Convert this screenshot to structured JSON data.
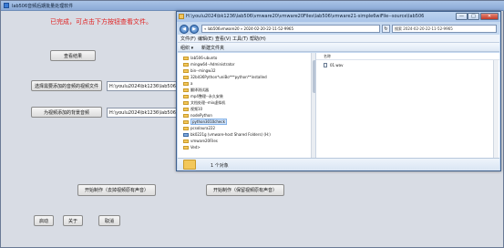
{
  "app": {
    "title": "lab506音频后期批量处理软件",
    "status": "已完成，可点击下方按钮查看文件。",
    "view_button": "查看结果",
    "select_dir_button": "选择需要添加的音频的视频文件",
    "select_dir_value": "H:\\youlu2024\\bk1236\\lab506\\",
    "bgm_button": "为视频添加的背景音频",
    "bgm_value": "H:\\youlu2024\\bk1236\\lab506\\",
    "start_remove_button": "开始制作（去掉视频原有声音）",
    "start_keep_button": "开始制作（保留视频原有声音）",
    "readme_button": "启动",
    "about_button": "关于",
    "close_button": "取消"
  },
  "explorer": {
    "title": "H:\\youlu2024\\bk1236\\lab506\\vmware20\\vmware20Files\\lab506\\vmware21-simple6wiFile--source\\lab506",
    "address": "« lab506vmware20 » 2024-02-20-22-11-52-9965",
    "search_placeholder": "搜索 2024-02-20-22-11-52-9965",
    "menu": [
      "文件(F)",
      "编辑(E)",
      "查看(V)",
      "工具(T)",
      "帮助(H)"
    ],
    "toolbar": {
      "organize": "组织 ▾",
      "new_folder": "新建文件夹"
    },
    "tree": [
      "lab506-ubunto",
      "mingw64--Administrator",
      "bin--mingw32",
      "32bit36Python*uniBo***python**installed",
      "a",
      "翻译测试器",
      "mp4整理--永久安装",
      "文档处理--mix虚拟机",
      "视频10",
      "nodePython",
      "python3010check",
      "pcsolaura222",
      "bk0221g (vmware-host Shared Folders) (H:)",
      "vmware20Files",
      "Ved>"
    ],
    "column_name": "名称",
    "file": "01.wav",
    "details_count": "1 个对象",
    "window_buttons": {
      "minimize": "—",
      "maximize": "□",
      "close": "✕"
    },
    "nav": {
      "back": "◀",
      "forward": "▶",
      "refresh": "↻"
    }
  }
}
